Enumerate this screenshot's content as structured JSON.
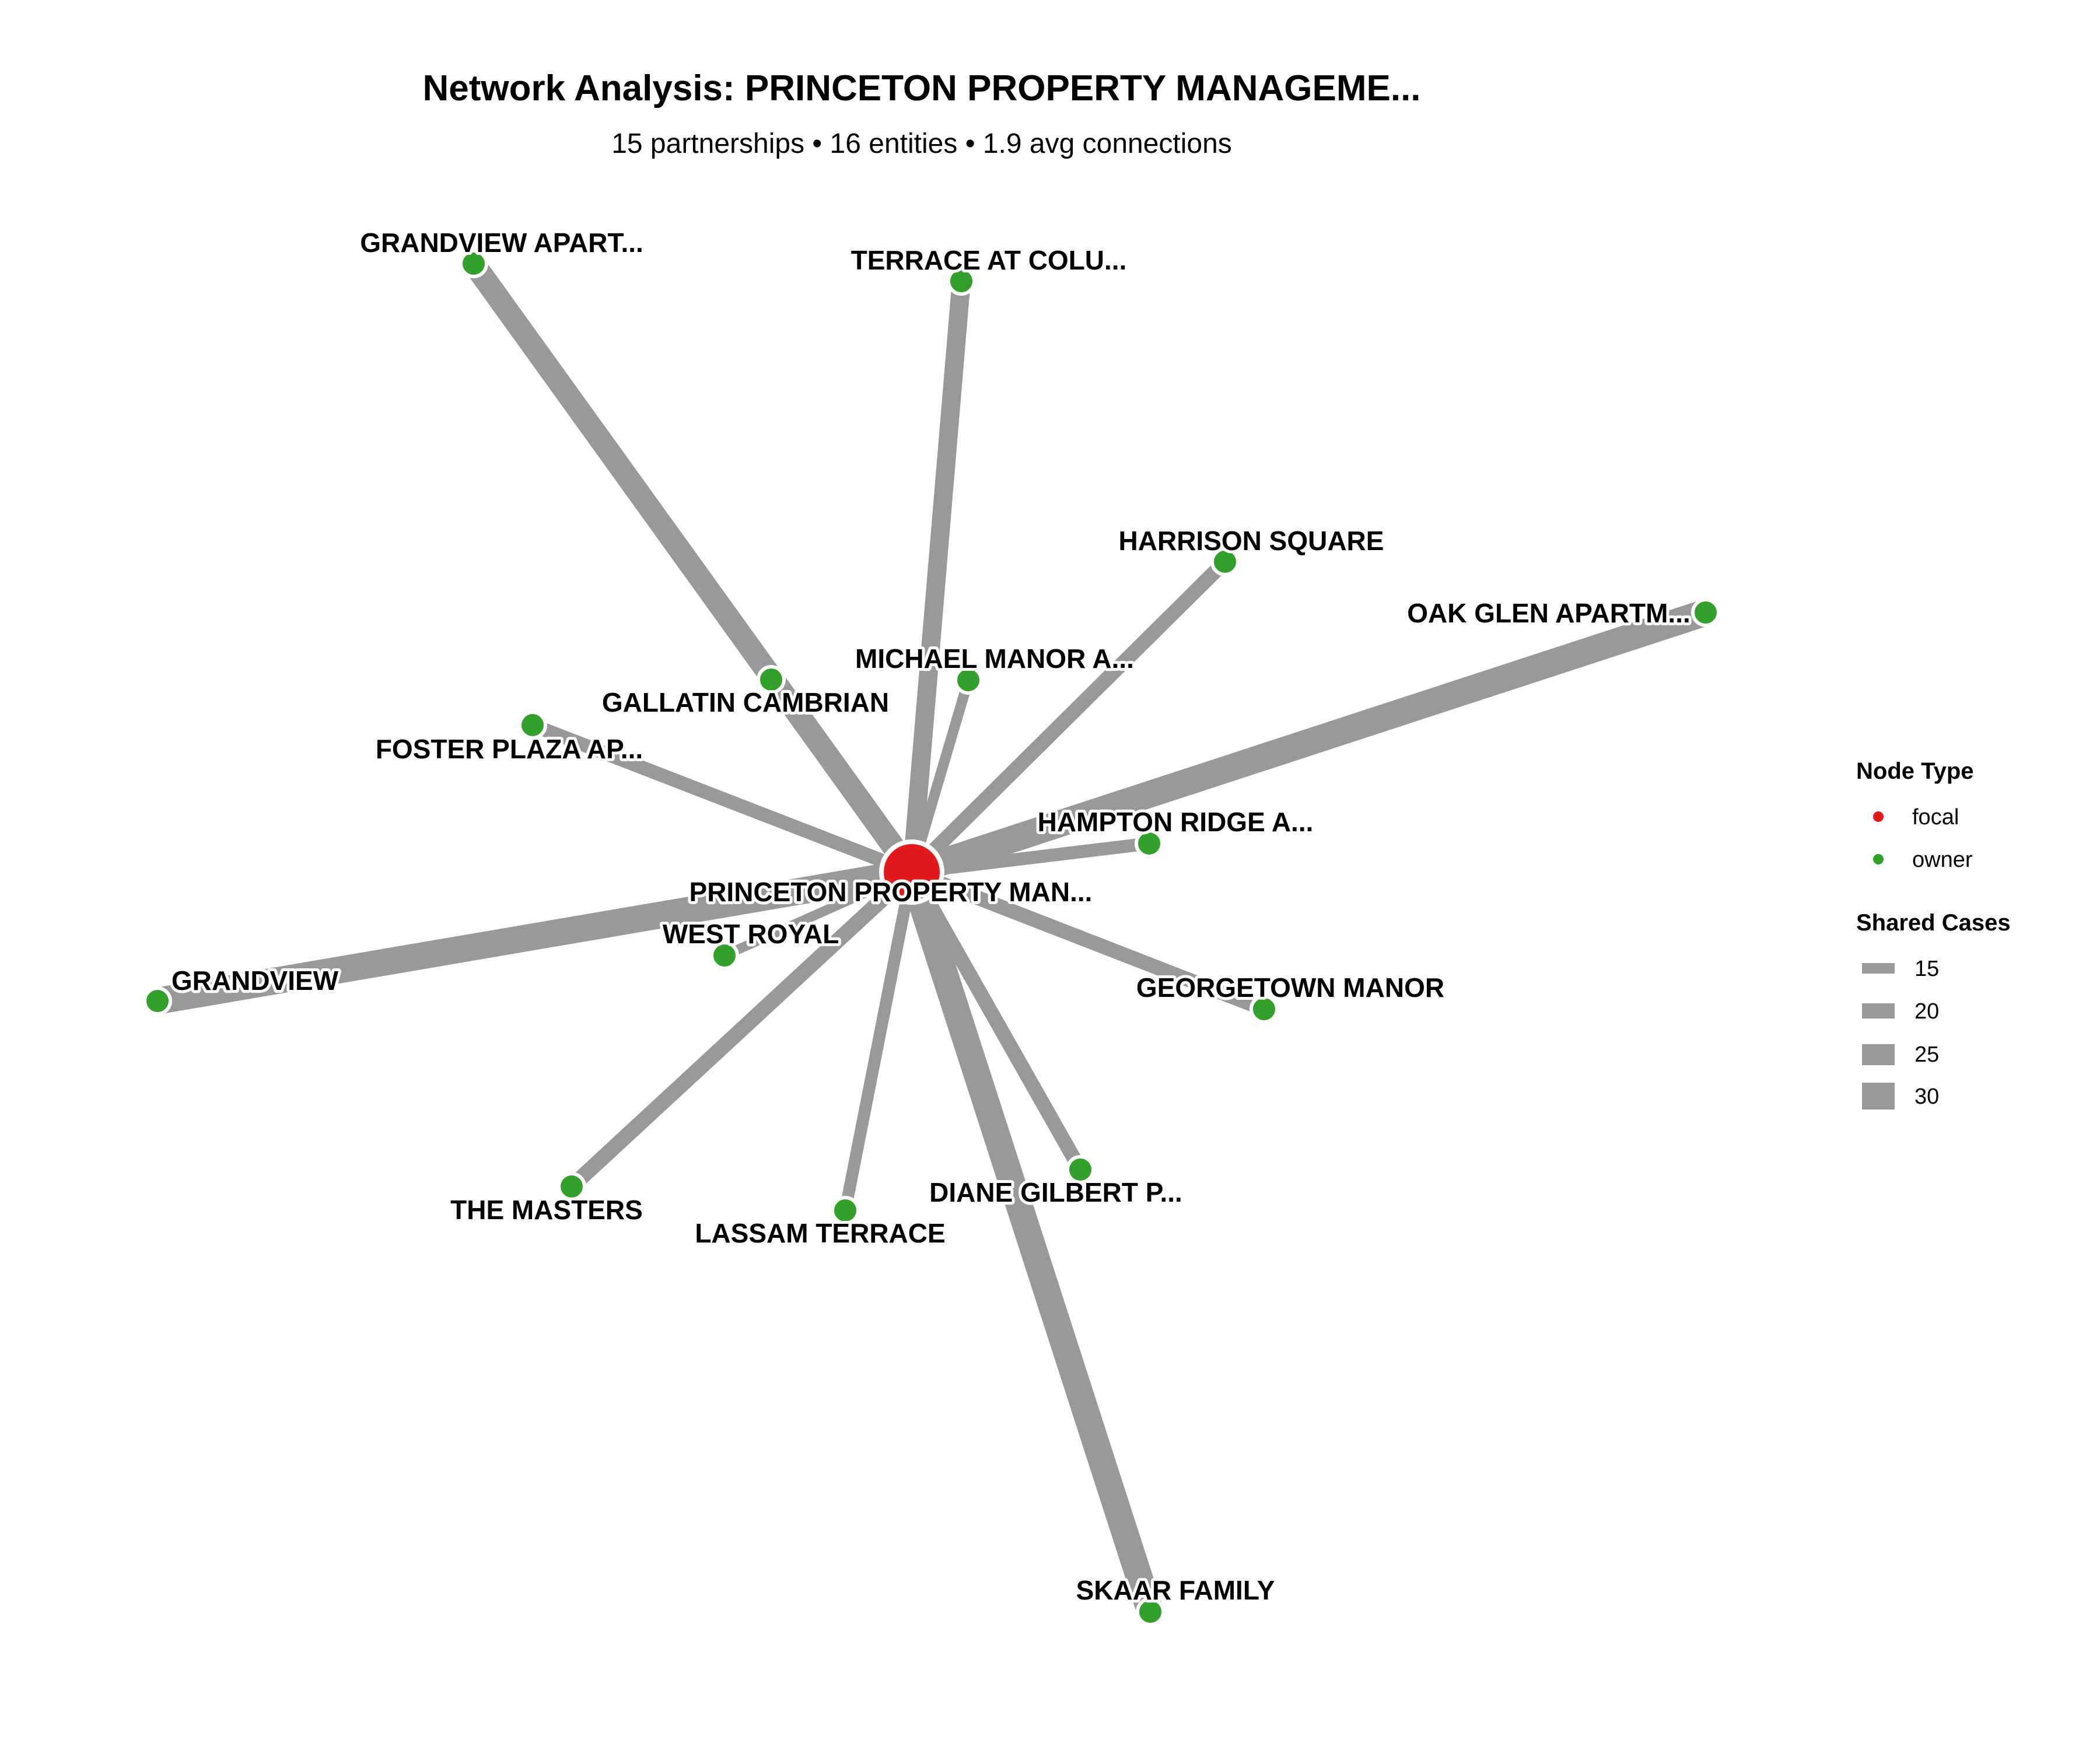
{
  "header": {
    "title": "Network Analysis: PRINCETON PROPERTY MANAGEME...",
    "subtitle": "15 partnerships • 16 entities • 1.9 avg connections"
  },
  "colors": {
    "focal": "#e31a1c",
    "owner": "#33a02c",
    "edge": "#999999",
    "node_outline": "#ffffff"
  },
  "network": {
    "focal": {
      "label": "PRINCETON PROPERTY MAN...",
      "type": "focal"
    },
    "nodes": [
      {
        "label": "GRANDVIEW APART...",
        "type": "owner",
        "shared_cases": 25
      },
      {
        "label": "TERRACE AT COLU...",
        "type": "owner",
        "shared_cases": 20
      },
      {
        "label": "HARRISON SQUARE",
        "type": "owner",
        "shared_cases": 15
      },
      {
        "label": "OAK GLEN APARTM...",
        "type": "owner",
        "shared_cases": 30
      },
      {
        "label": "MICHAEL MANOR A...",
        "type": "owner",
        "shared_cases": 10
      },
      {
        "label": "GALLATIN CAMBRIAN",
        "type": "owner",
        "shared_cases": 14
      },
      {
        "label": "FOSTER PLAZA AP...",
        "type": "owner",
        "shared_cases": 14
      },
      {
        "label": "HAMPTON RIDGE A...",
        "type": "owner",
        "shared_cases": 13
      },
      {
        "label": "WEST ROYAL",
        "type": "owner",
        "shared_cases": 9
      },
      {
        "label": "GRANDVIEW",
        "type": "owner",
        "shared_cases": 30
      },
      {
        "label": "GEORGETOWN MANOR",
        "type": "owner",
        "shared_cases": 15
      },
      {
        "label": "THE MASTERS",
        "type": "owner",
        "shared_cases": 16
      },
      {
        "label": "LASSAM TERRACE",
        "type": "owner",
        "shared_cases": 12
      },
      {
        "label": "DIANE GILBERT P...",
        "type": "owner",
        "shared_cases": 15
      },
      {
        "label": "SKAAR FAMILY",
        "type": "owner",
        "shared_cases": 30
      }
    ]
  },
  "legend": {
    "node_type_title": "Node Type",
    "node_types": [
      {
        "label": "focal",
        "color": "#e31a1c"
      },
      {
        "label": "owner",
        "color": "#33a02c"
      }
    ],
    "shared_cases_title": "Shared Cases",
    "shared_cases": [
      {
        "label": "15",
        "value": 15
      },
      {
        "label": "20",
        "value": 20
      },
      {
        "label": "25",
        "value": 25
      },
      {
        "label": "30",
        "value": 30
      }
    ]
  }
}
